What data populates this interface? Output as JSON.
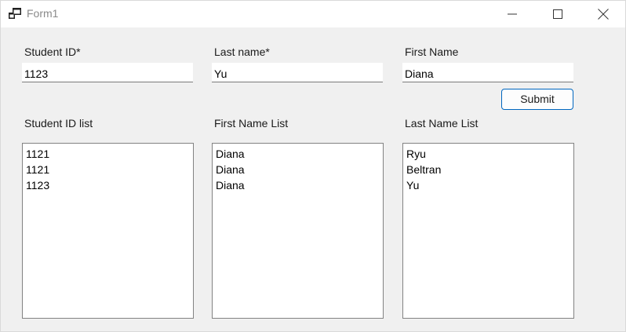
{
  "window": {
    "title": "Form1"
  },
  "form": {
    "student_id": {
      "label": "Student ID*",
      "value": "1123"
    },
    "last_name": {
      "label": "Last name*",
      "value": "Yu"
    },
    "first_name": {
      "label": "First Name",
      "value": "Diana"
    },
    "submit_label": "Submit"
  },
  "lists": {
    "student_id_list": {
      "label": "Student ID list",
      "items": [
        "1121",
        "1121",
        "1123"
      ]
    },
    "first_name_list": {
      "label": "First Name List",
      "items": [
        "Diana",
        "Diana",
        "Diana"
      ]
    },
    "last_name_list": {
      "label": "Last Name List",
      "items": [
        "Ryu",
        "Beltran",
        "Yu"
      ]
    }
  },
  "icons": {
    "app": "app-icon",
    "minimize": "minimize-icon",
    "maximize": "maximize-icon",
    "close": "close-icon"
  },
  "colors": {
    "accent": "#0067c0",
    "window_bg": "#f0f0f0",
    "title_text": "#8a8a8a"
  }
}
